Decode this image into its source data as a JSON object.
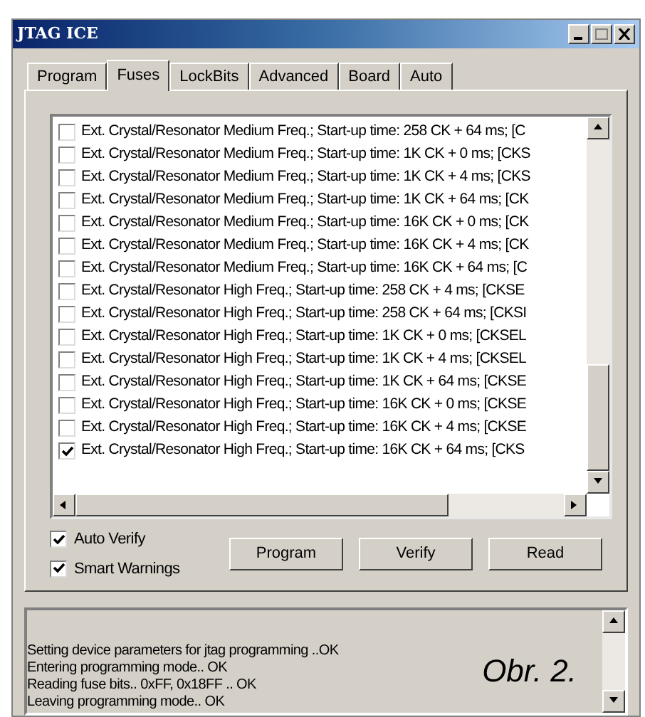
{
  "window": {
    "title": "JTAG ICE"
  },
  "tabs": [
    {
      "label": "Program",
      "selected": false
    },
    {
      "label": "Fuses",
      "selected": true
    },
    {
      "label": "LockBits",
      "selected": false
    },
    {
      "label": "Advanced",
      "selected": false
    },
    {
      "label": "Board",
      "selected": false
    },
    {
      "label": "Auto",
      "selected": false
    }
  ],
  "fuse_list": [
    {
      "label": "Ext. Crystal/Resonator Medium Freq.; Start-up time: 258 CK + 64 ms; [C",
      "checked": false
    },
    {
      "label": "Ext. Crystal/Resonator Medium Freq.; Start-up time: 1K CK + 0 ms; [CKS",
      "checked": false
    },
    {
      "label": "Ext. Crystal/Resonator Medium Freq.; Start-up time: 1K CK + 4 ms; [CKS",
      "checked": false
    },
    {
      "label": "Ext. Crystal/Resonator Medium Freq.; Start-up time: 1K CK + 64 ms; [CK",
      "checked": false
    },
    {
      "label": "Ext. Crystal/Resonator Medium Freq.; Start-up time: 16K CK + 0 ms; [CK",
      "checked": false
    },
    {
      "label": "Ext. Crystal/Resonator Medium Freq.; Start-up time: 16K CK + 4 ms; [CK",
      "checked": false
    },
    {
      "label": "Ext. Crystal/Resonator Medium Freq.; Start-up time: 16K CK + 64 ms; [C",
      "checked": false
    },
    {
      "label": "Ext. Crystal/Resonator High Freq.; Start-up time: 258 CK + 4 ms; [CKSE",
      "checked": false
    },
    {
      "label": "Ext. Crystal/Resonator High Freq.; Start-up time: 258 CK + 64 ms; [CKSI",
      "checked": false
    },
    {
      "label": "Ext. Crystal/Resonator High Freq.; Start-up time: 1K CK + 0 ms; [CKSEL",
      "checked": false
    },
    {
      "label": "Ext. Crystal/Resonator High Freq.; Start-up time: 1K CK + 4 ms; [CKSEL",
      "checked": false
    },
    {
      "label": "Ext. Crystal/Resonator High Freq.; Start-up time: 1K CK + 64 ms; [CKSE",
      "checked": false
    },
    {
      "label": "Ext. Crystal/Resonator High Freq.; Start-up time: 16K CK + 0 ms; [CKSE",
      "checked": false
    },
    {
      "label": "Ext. Crystal/Resonator High Freq.; Start-up time: 16K CK + 4 ms; [CKSE",
      "checked": false
    },
    {
      "label": "Ext. Crystal/Resonator High Freq.; Start-up time: 16K CK + 64 ms; [CKS",
      "checked": true
    }
  ],
  "options": [
    {
      "label": "Auto Verify",
      "checked": true
    },
    {
      "label": "Smart Warnings",
      "checked": true
    }
  ],
  "buttons": [
    "Program",
    "Verify",
    "Read"
  ],
  "log": [
    "Setting device parameters for jtag programming ..OK",
    "Entering programming mode.. OK",
    "Reading fuse bits.. 0xFF, 0x18FF .. OK",
    "Leaving programming mode.. OK"
  ],
  "caption": "Obr. 2."
}
